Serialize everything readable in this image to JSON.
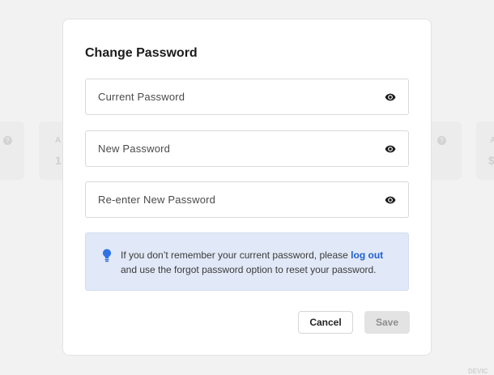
{
  "background": {
    "help_glyph": "?",
    "card_fragments": [
      "A",
      "1",
      "A",
      "$"
    ],
    "bottom_right_fragment": "DEVIC"
  },
  "modal": {
    "title": "Change Password",
    "fields": [
      {
        "label": "Current Password",
        "icon": "eye-icon"
      },
      {
        "label": "New Password",
        "icon": "eye-icon"
      },
      {
        "label": "Re-enter New Password",
        "icon": "eye-icon"
      }
    ],
    "info": {
      "icon": "lightbulb-icon",
      "text_before": "If you don’t remember your current password, please",
      "link": "log out",
      "text_after": "and use the forgot password option to reset your password.",
      "color": "#1f5fd0",
      "background": "#e1e8f7"
    },
    "cancel_label": "Cancel",
    "save_label": "Save"
  }
}
